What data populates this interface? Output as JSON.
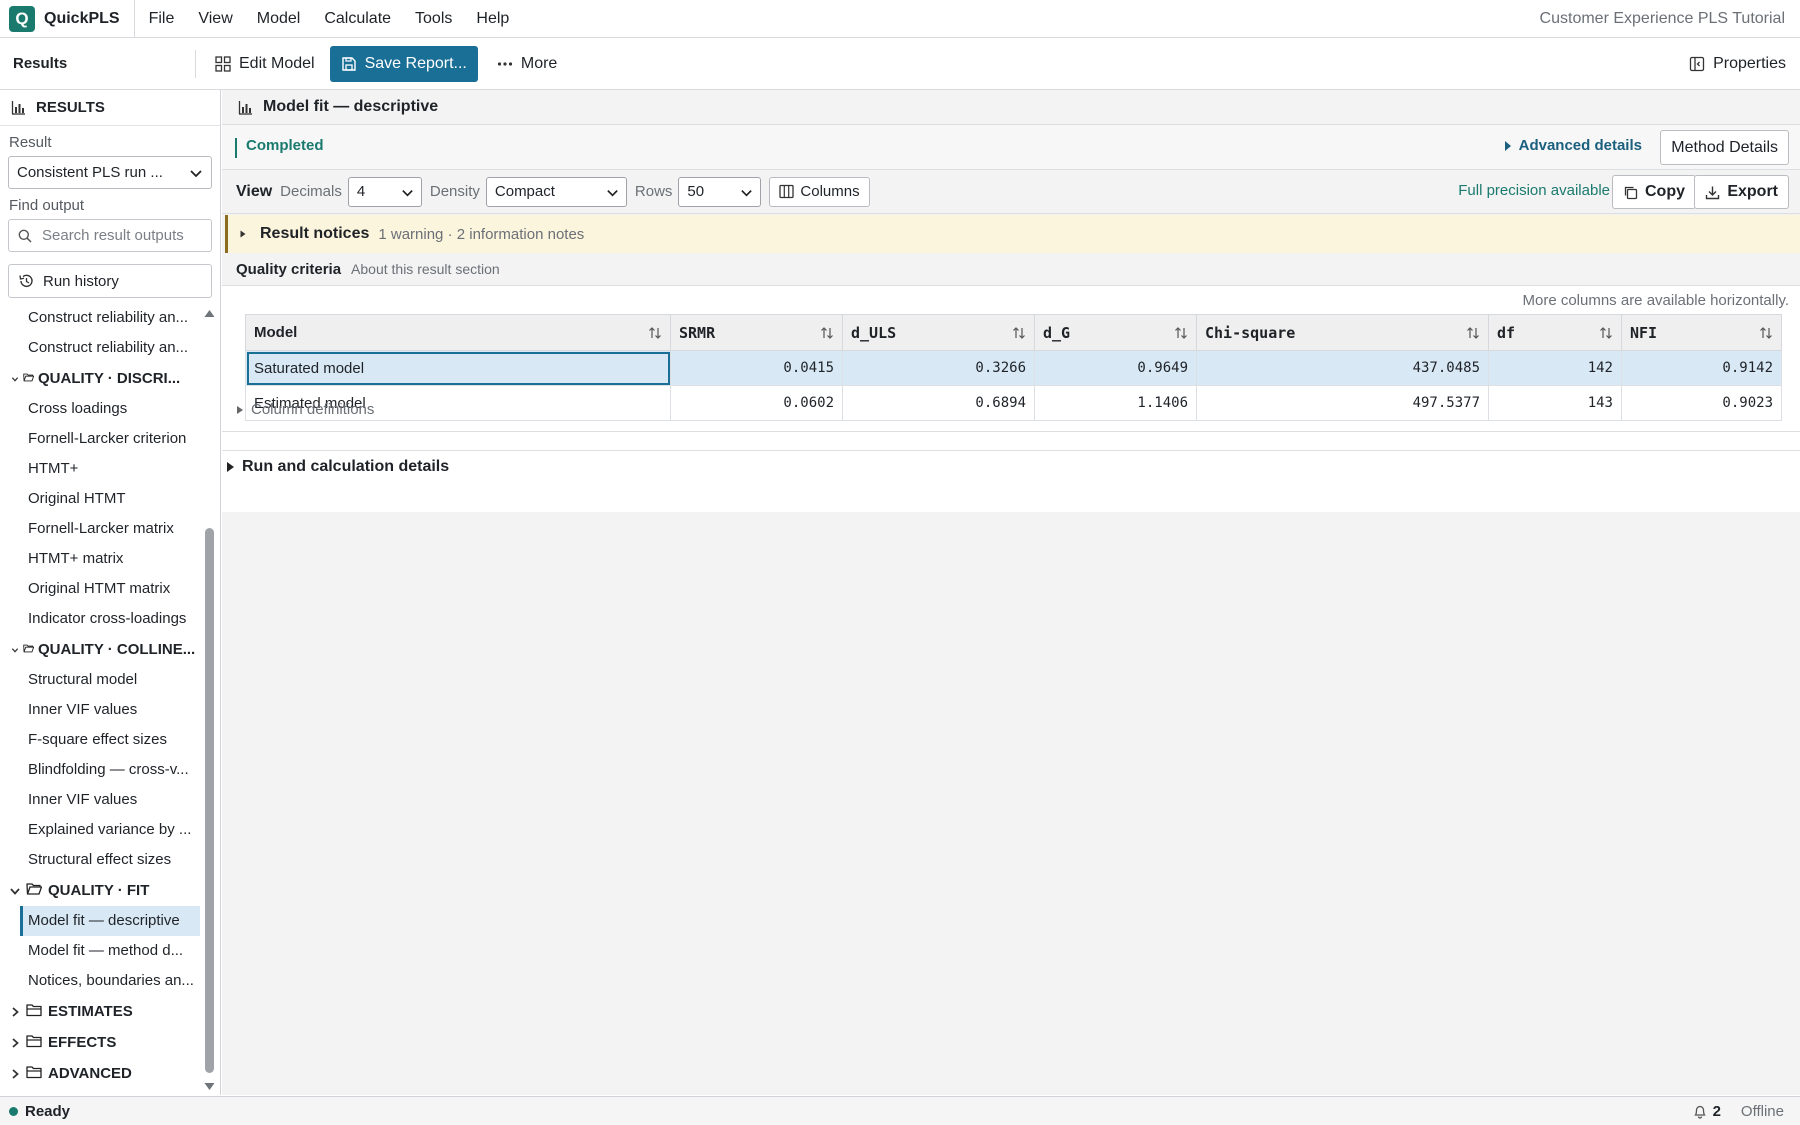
{
  "app": {
    "logo_letter": "Q",
    "name": "QuickPLS",
    "document_title": "Customer Experience PLS Tutorial"
  },
  "menu": [
    "File",
    "View",
    "Model",
    "Calculate",
    "Tools",
    "Help"
  ],
  "toolbar": {
    "title": "Results",
    "edit_model": "Edit Model",
    "save_report": "Save Report...",
    "more": "More",
    "properties": "Properties"
  },
  "sidebar": {
    "header": "RESULTS",
    "result_label": "Result",
    "result_value": "Consistent PLS run ...",
    "find_label": "Find output",
    "search_placeholder": "Search result outputs",
    "run_history": "Run history",
    "tree": [
      {
        "kind": "item",
        "label": "Construct reliability an..."
      },
      {
        "kind": "item",
        "label": "Construct reliability an..."
      },
      {
        "kind": "group",
        "label": "QUALITY · DISCRI...",
        "expanded": true,
        "small": true
      },
      {
        "kind": "item",
        "label": "Cross loadings"
      },
      {
        "kind": "item",
        "label": "Fornell-Larcker criterion"
      },
      {
        "kind": "item",
        "label": "HTMT+"
      },
      {
        "kind": "item",
        "label": "Original HTMT"
      },
      {
        "kind": "item",
        "label": "Fornell-Larcker matrix"
      },
      {
        "kind": "item",
        "label": "HTMT+ matrix"
      },
      {
        "kind": "item",
        "label": "Original HTMT matrix"
      },
      {
        "kind": "item",
        "label": "Indicator cross-loadings"
      },
      {
        "kind": "group",
        "label": "QUALITY · COLLINE...",
        "expanded": true,
        "small": true
      },
      {
        "kind": "item",
        "label": "Structural model"
      },
      {
        "kind": "item",
        "label": "Inner VIF values"
      },
      {
        "kind": "item",
        "label": "F-square effect sizes"
      },
      {
        "kind": "item",
        "label": "Blindfolding — cross-v..."
      },
      {
        "kind": "item",
        "label": "Inner VIF values"
      },
      {
        "kind": "item",
        "label": "Explained variance by ..."
      },
      {
        "kind": "item",
        "label": "Structural effect sizes"
      },
      {
        "kind": "group",
        "label": "QUALITY · FIT",
        "expanded": true
      },
      {
        "kind": "item",
        "label": "Model fit — descriptive",
        "selected": true
      },
      {
        "kind": "item",
        "label": "Model fit — method d..."
      },
      {
        "kind": "item",
        "label": "Notices, boundaries an..."
      },
      {
        "kind": "group",
        "label": "ESTIMATES",
        "expanded": false
      },
      {
        "kind": "group",
        "label": "EFFECTS",
        "expanded": false
      },
      {
        "kind": "group",
        "label": "ADVANCED",
        "expanded": false
      }
    ]
  },
  "main": {
    "title": "Model fit — descriptive",
    "status": "Completed",
    "advanced_details": "Advanced details",
    "method_details": "Method Details",
    "view": {
      "label": "View",
      "decimals_label": "Decimals",
      "decimals_value": "4",
      "density_label": "Density",
      "density_value": "Compact",
      "rows_label": "Rows",
      "rows_value": "50",
      "columns_button": "Columns",
      "full_precision": "Full precision available",
      "copy": "Copy",
      "export": "Export"
    },
    "notices": {
      "title": "Result notices",
      "summary": "1 warning · 2 information notes"
    },
    "section": {
      "title": "Quality criteria",
      "about": "About this result section"
    },
    "more_columns_hint": "More columns are available horizontally.",
    "table": {
      "columns": [
        "Model",
        "SRMR",
        "d_ULS",
        "d_G",
        "Chi-square",
        "df",
        "NFI"
      ],
      "rows": [
        [
          "Saturated model",
          "0.0415",
          "0.3266",
          "0.9649",
          "437.0485",
          "142",
          "0.9142"
        ],
        [
          "Estimated model",
          "0.0602",
          "0.6894",
          "1.1406",
          "497.5377",
          "143",
          "0.9023"
        ]
      ]
    },
    "column_definitions": "Column definitions",
    "run_details": "Run and calculation details"
  },
  "statusbar": {
    "ready": "Ready",
    "notifications": "2",
    "connection": "Offline"
  },
  "colors": {
    "accent": "#1a6f96",
    "brand": "#1a7a6e",
    "notice_bg": "#fcf5dd",
    "selection": "#d8e8f5"
  }
}
